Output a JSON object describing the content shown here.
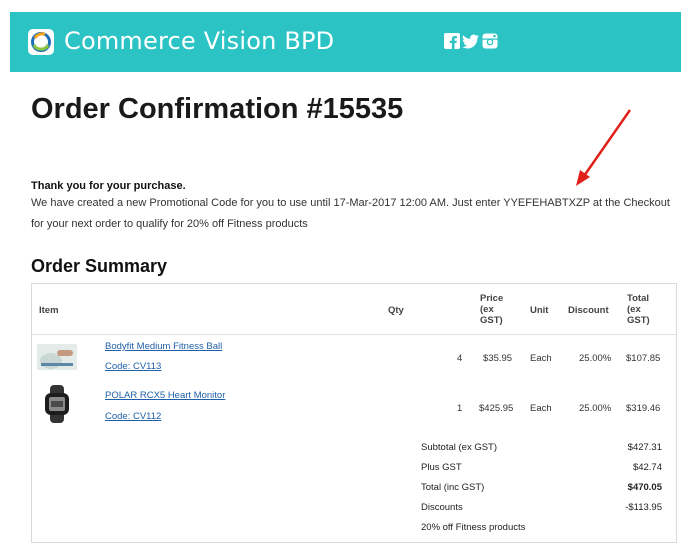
{
  "header": {
    "brand": "Commerce Vision BPD",
    "social_icons": [
      "facebook-icon",
      "twitter-icon",
      "instagram-icon"
    ],
    "bg_color": "#2cc3c5"
  },
  "title": "Order Confirmation #15535",
  "thanks": "Thank you for your purchase.",
  "promo_message": "We have created a new Promotional Code for you to use until 17-Mar-2017 12:00 AM. Just enter YYEFEHABTXZP at the Checkout for your next order to qualify for 20% off Fitness products",
  "summary_heading": "Order Summary",
  "table": {
    "headers": {
      "item": "Item",
      "qty": "Qty",
      "price": "Price (ex GST)",
      "unit": "Unit",
      "discount": "Discount",
      "total": "Total (ex GST)"
    },
    "rows": [
      {
        "name": "Bodyfit Medium Fitness Ball",
        "code": "Code: CV113",
        "qty": "4",
        "price": "$35.95",
        "unit": "Each",
        "discount": "25.00%",
        "total": "$107.85"
      },
      {
        "name": "POLAR RCX5 Heart Monitor",
        "code": "Code: CV112",
        "qty": "1",
        "price": "$425.95",
        "unit": "Each",
        "discount": "25.00%",
        "total": "$319.46"
      }
    ],
    "totals": [
      {
        "label": "Subtotal (ex GST)",
        "value": "$427.31"
      },
      {
        "label": "Plus GST",
        "value": "$42.74"
      },
      {
        "label": "Total (inc GST)",
        "value": "$470.05"
      },
      {
        "label": "Discounts",
        "value": "-$113.95"
      },
      {
        "label": "20% off Fitness products",
        "value": ""
      }
    ]
  },
  "link_color": "#1f5fa8",
  "annotation_color": "#e0201b"
}
